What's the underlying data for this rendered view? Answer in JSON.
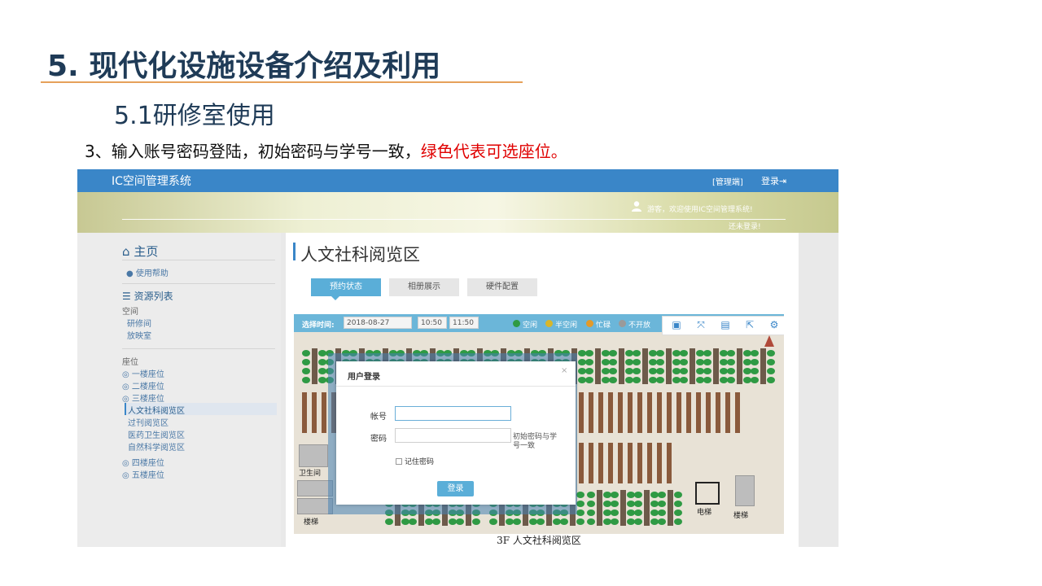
{
  "slide": {
    "title": "5. 现代化设施设备介绍及利用",
    "subtitle": "5.1研修室使用",
    "instruction_black": "3、输入账号密码登陆，初始密码与学号一致，",
    "instruction_red": "绿色代表可选座位。"
  },
  "app": {
    "name": "IC空间管理系统",
    "admin_link": "[管理端]",
    "login_link": "登录⇥",
    "welcome_line1": "游客，欢迎使用IC空间管理系统!",
    "welcome_line2": "还未登录!"
  },
  "sidebar": {
    "home": "主页",
    "help": "使用帮助",
    "resource_list": "资源列表",
    "space_group": "空间",
    "space_items": [
      "研修间",
      "放映室"
    ],
    "seat_group": "座位",
    "floor1": "一楼座位",
    "floor2": "二楼座位",
    "floor3": "三楼座位",
    "floor3_items": [
      "人文社科阅览区",
      "过刊阅览区",
      "医药卫生阅览区",
      "自然科学阅览区"
    ],
    "floor4": "四楼座位",
    "floor5": "五楼座位"
  },
  "main": {
    "heading": "人文社科阅览区",
    "tabs": [
      "预约状态",
      "相册展示",
      "硬件配置"
    ]
  },
  "map": {
    "select_time_label": "选择时间:",
    "date": "2018-08-27",
    "time_start": "10:50",
    "time_end": "11:50",
    "legend": [
      {
        "label": "空闲",
        "color": "#2f9a44"
      },
      {
        "label": "半空闲",
        "color": "#d8b62a"
      },
      {
        "label": "忙碌",
        "color": "#e39a2a"
      },
      {
        "label": "不开放",
        "color": "#9a9a9a"
      }
    ],
    "labels": {
      "restroom": "卫生间",
      "stairs_left": "楼梯",
      "elevator": "电梯",
      "stairs_right": "楼梯",
      "caption": "3F  人文社科阅览区"
    }
  },
  "login_modal": {
    "title": "用户登录",
    "close": "×",
    "account_label": "帐号",
    "account_value": "",
    "password_label": "密码",
    "password_value": "",
    "password_hint": "初始密码与学号一致",
    "remember": "记住密码",
    "submit": "登录"
  }
}
